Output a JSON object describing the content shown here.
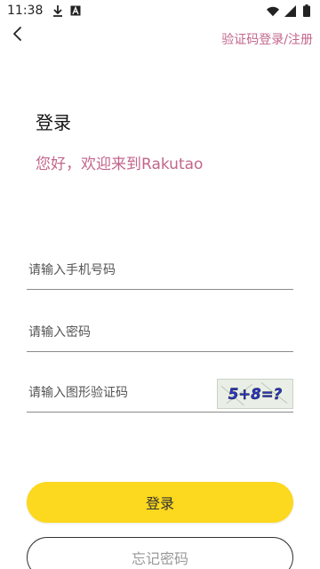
{
  "status_bar": {
    "time": "11:38",
    "icons": [
      "download-icon",
      "font-app-icon",
      "wifi-icon",
      "signal-icon",
      "battery-icon"
    ]
  },
  "header": {
    "back_icon": "chevron-left-icon",
    "switch_link": "验证码登录/注册"
  },
  "main": {
    "title": "登录",
    "welcome": "您好，欢迎来到Rakutao"
  },
  "form": {
    "phone_placeholder": "请输入手机号码",
    "password_placeholder": "请输入密码",
    "captcha_placeholder": "请输入图形验证码",
    "captcha_text": "5+8=?"
  },
  "buttons": {
    "login_label": "登录",
    "forgot_label": "忘记密码"
  },
  "colors": {
    "accent": "#c2668b",
    "primary_button": "#fcd81e"
  }
}
